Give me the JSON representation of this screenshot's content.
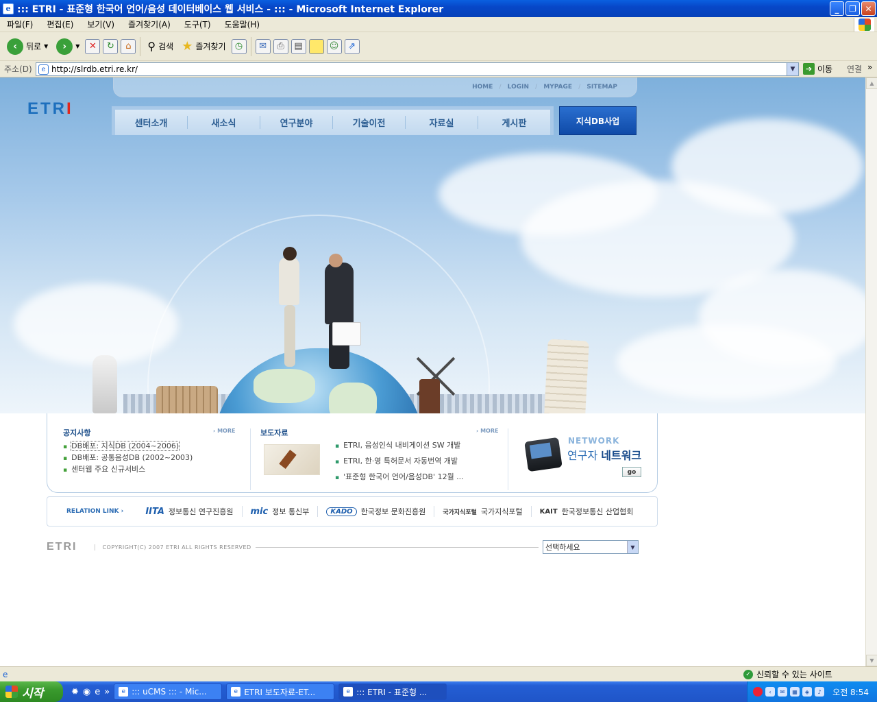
{
  "window": {
    "title": "::: ETRI - 표준형 한국어 언어/음성 데이터베이스 웹 서비스 - ::: - Microsoft Internet Explorer",
    "buttons": {
      "minimize": "_",
      "restore": "❐",
      "close": "✕"
    }
  },
  "menu": [
    "파일(F)",
    "편집(E)",
    "보기(V)",
    "즐겨찾기(A)",
    "도구(T)",
    "도움말(H)"
  ],
  "toolbar": {
    "back": "뒤로",
    "search": "검색",
    "favorites": "즐겨찾기"
  },
  "address": {
    "label": "주소(D)",
    "url": "http://slrdb.etri.re.kr/",
    "go": "이동",
    "links": "연결"
  },
  "site": {
    "logo_main": "ETR",
    "logo_accent": "I",
    "top_links": [
      "HOME",
      "LOGIN",
      "MYPAGE",
      "SITEMAP"
    ],
    "top_link_separator": "/",
    "gnb": [
      "센터소개",
      "새소식",
      "연구분야",
      "기술이전",
      "자료실",
      "게시판"
    ],
    "db_button": "지식DB사업"
  },
  "notice": {
    "title": "공지사항",
    "more": "› MORE",
    "items": [
      "DB배포: 지식DB (2004~2006)",
      "DB배포: 공통음성DB (2002~2003)",
      "센터웹 주요 신규서비스"
    ]
  },
  "press": {
    "title": "보도자료",
    "more": "› MORE",
    "items": [
      "ETRI, 음성인식 내비게이션 SW 개발",
      "ETRI, 한·영 특허문서 자동번역 개발",
      "'표준형 한국어 언어/음성DB' 12월 ..."
    ]
  },
  "network": {
    "label": "NETWORK",
    "sub_light": "연구자 ",
    "sub_bold": "네트워크",
    "go": "go"
  },
  "relation": {
    "title": "RELATION LINK ›",
    "items": [
      {
        "logo": "IITA",
        "label": "정보통신 연구진흥원"
      },
      {
        "logo": "mic",
        "label": "정보 통신부"
      },
      {
        "logo": "KADO",
        "label": "한국정보 문화진흥원"
      },
      {
        "logo": "국가지식포털",
        "label": "국가지식포털"
      },
      {
        "logo": "KAIT",
        "label": "한국정보통신 산업협회"
      }
    ]
  },
  "footer": {
    "logo": "ETRI",
    "copyright": "COPYRIGHT(C) 2007 ETRI ALL RIGHTS RESERVED",
    "select": "선택하세요"
  },
  "status": {
    "zone": "신뢰할 수 있는 사이트"
  },
  "taskbar": {
    "start": "시작",
    "tasks": [
      "::: uCMS ::: - Mic...",
      "ETRI 보도자료-ET...",
      "::: ETRI - 표준형 ..."
    ],
    "clock": "오전 8:54"
  }
}
